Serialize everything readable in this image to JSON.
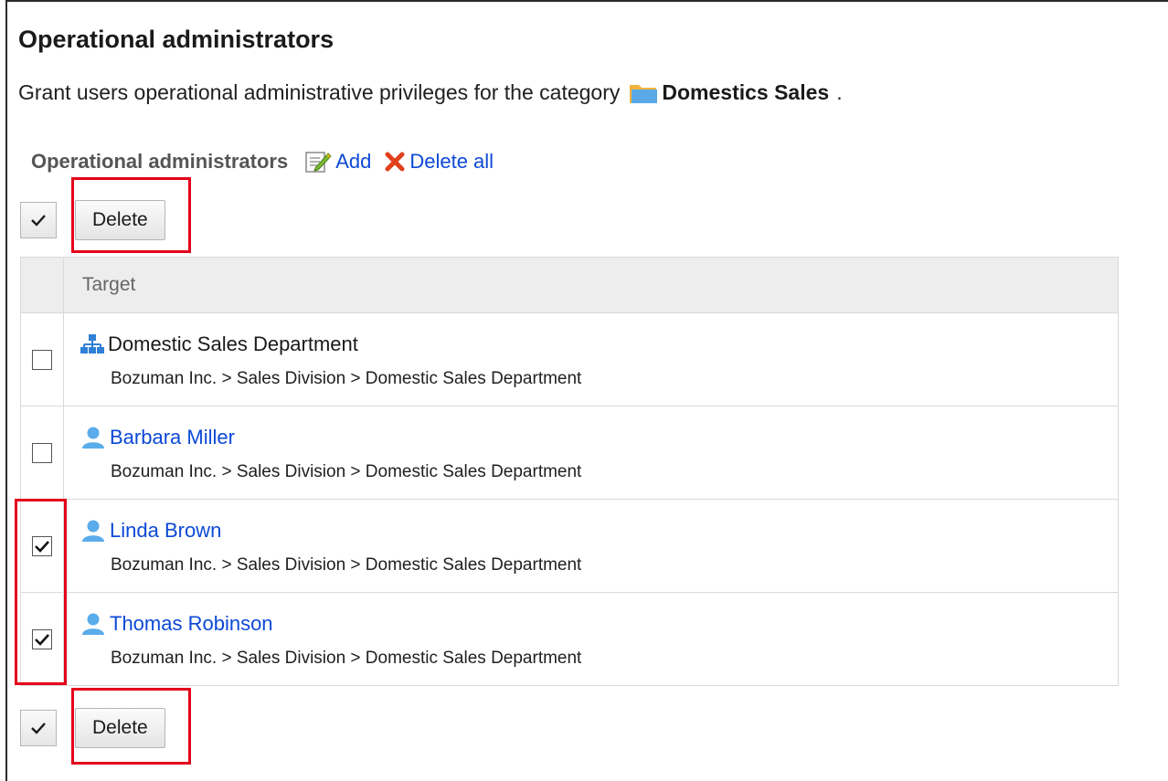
{
  "page": {
    "title": "Operational administrators",
    "description_prefix": "Grant users operational administrative privileges for the category",
    "category_name": "Domestics Sales",
    "description_suffix": "."
  },
  "section": {
    "label": "Operational administrators",
    "add_label": "Add",
    "delete_all_label": "Delete all"
  },
  "toolbar": {
    "check_all_icon": "checkmark-icon",
    "delete_label": "Delete"
  },
  "table": {
    "header": "Target",
    "rows": [
      {
        "type": "department",
        "icon": "organization-icon",
        "name": "Domestic Sales Department",
        "path": "Bozuman Inc. > Sales Division > Domestic Sales Department",
        "checked": false
      },
      {
        "type": "user",
        "icon": "user-icon",
        "name": "Barbara Miller",
        "path": "Bozuman Inc. > Sales Division > Domestic Sales Department",
        "checked": false
      },
      {
        "type": "user",
        "icon": "user-icon",
        "name": "Linda Brown",
        "path": "Bozuman Inc. > Sales Division > Domestic Sales Department",
        "checked": true
      },
      {
        "type": "user",
        "icon": "user-icon",
        "name": "Thomas Robinson",
        "path": "Bozuman Inc. > Sales Division > Domestic Sales Department",
        "checked": true
      }
    ]
  },
  "colors": {
    "link": "#0c49d6",
    "highlight": "#e3001b",
    "header_bg": "#ededed"
  }
}
